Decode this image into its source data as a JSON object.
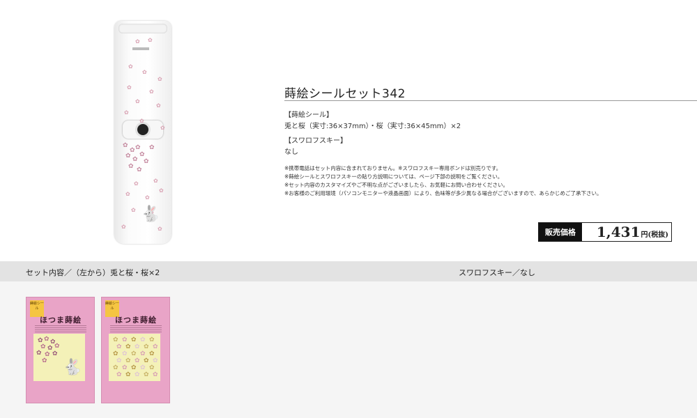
{
  "product": {
    "title": "蒔絵シールセット342",
    "phone_image": "flip-phone-with-sakura-and-rabbit-maki-e"
  },
  "specs": [
    {
      "label": "【蒔絵シール】",
      "value": "兎と桜（実寸:36×37mm）・桜（実寸:36×45mm）×2"
    },
    {
      "label": "【スワロフスキー】",
      "value": "なし"
    }
  ],
  "notes": [
    "※携帯電話はセット内容に含まれておりません。※スワロフスキー専用ボンドは別売りです。",
    "※蒔絵シールとスワロフスキーの貼り方説明については、ページ下部の説明をご覧ください。",
    "※セット内容のカスタマイズやご不明な点がございましたら、お気軽にお問い合わせください。",
    "※お客様のご利用環境（パソコンモニターや液晶画面）により、色味等が多少異なる場合がございますので、あらかじめご了承下さい。"
  ],
  "price": {
    "label": "販売価格",
    "amount": "1,431",
    "unit": "円(税抜)"
  },
  "set_contents": {
    "left_header": "セット内容／（左から）兎と桜・桜×2",
    "right_header": "スワロフスキー／なし",
    "packs": [
      {
        "tag": "蒔絵シール",
        "title": "ほつま蒔絵",
        "variant": "rabbit-and-sakura"
      },
      {
        "tag": "蒔絵シール",
        "title": "ほつま蒔絵",
        "variant": "sakura"
      }
    ]
  },
  "colors": {
    "price_label_bg": "#111111",
    "bottom_header_bg": "#e3e3e3",
    "pack_pink": "#e9a4c7",
    "sheet_yellow": "#f4f1b8"
  }
}
